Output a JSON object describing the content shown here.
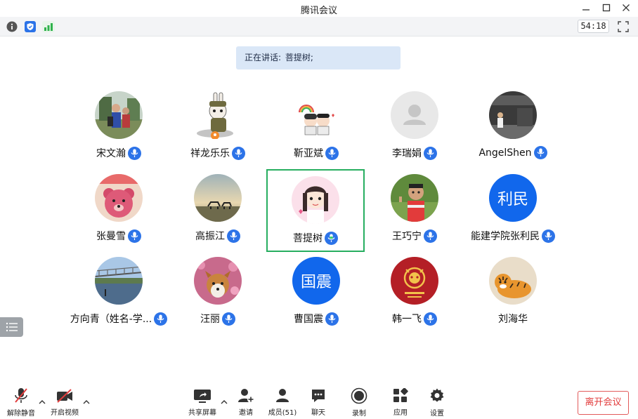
{
  "window": {
    "title": "腾讯会议"
  },
  "infobar": {
    "timer": "54:18"
  },
  "speaking": {
    "label": "正在讲话:",
    "name": "菩提树;"
  },
  "participants": [
    {
      "name": "宋文瀚",
      "avatar": "photo-person-outdoor"
    },
    {
      "name": "祥龙乐乐",
      "avatar": "cartoon-rabbit-soldier"
    },
    {
      "name": "靳亚斌",
      "avatar": "cartoon-couple-rainbow"
    },
    {
      "name": "李瑞娟",
      "avatar": "default-avatar"
    },
    {
      "name": "AngelShen",
      "avatar": "photo-person-night"
    },
    {
      "name": "张曼雪",
      "avatar": "pink-bear-toy"
    },
    {
      "name": "高振江",
      "avatar": "photo-horses-sunset"
    },
    {
      "name": "菩提树",
      "avatar": "cartoon-girl-pink",
      "speaking": true
    },
    {
      "name": "王巧宁",
      "avatar": "photo-child-thumbs-up"
    },
    {
      "name": "能建学院张利民",
      "avatar_text": "利民"
    },
    {
      "name": "方向青（姓名-学...",
      "avatar": "photo-bridge-river"
    },
    {
      "name": "汪丽",
      "avatar": "photo-dog-flowers"
    },
    {
      "name": "曹国震",
      "avatar_text": "国震"
    },
    {
      "name": "韩一飞",
      "avatar": "red-tiger-emblem"
    },
    {
      "name": "刘海华",
      "avatar": "cartoon-tiger",
      "no_mic": true
    }
  ],
  "toolbar": {
    "unmute": "解除静音",
    "start_video": "开启视频",
    "share_screen": "共享屏幕",
    "invite": "邀请",
    "members": "成员(51)",
    "chat": "聊天",
    "record": "录制",
    "apps": "应用",
    "settings": "设置",
    "leave": "离开会议"
  },
  "colors": {
    "accent": "#2c73e8",
    "active_border": "#27ae60",
    "leave": "#e23c3c"
  }
}
